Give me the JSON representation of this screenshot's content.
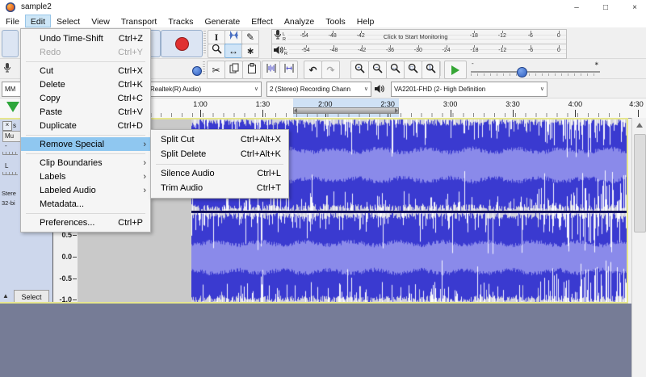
{
  "window": {
    "title": "sample2",
    "minimize": "–",
    "maximize": "□",
    "close": "×"
  },
  "menubar": {
    "items": [
      "File",
      "Edit",
      "Select",
      "View",
      "Transport",
      "Tracks",
      "Generate",
      "Effect",
      "Analyze",
      "Tools",
      "Help"
    ],
    "active": "Edit"
  },
  "edit_menu": {
    "items": [
      {
        "label": "Undo Time-Shift",
        "shortcut": "Ctrl+Z"
      },
      {
        "label": "Redo",
        "shortcut": "Ctrl+Y",
        "disabled": true,
        "separator_after": true
      },
      {
        "label": "Cut",
        "shortcut": "Ctrl+X"
      },
      {
        "label": "Delete",
        "shortcut": "Ctrl+K"
      },
      {
        "label": "Copy",
        "shortcut": "Ctrl+C"
      },
      {
        "label": "Paste",
        "shortcut": "Ctrl+V"
      },
      {
        "label": "Duplicate",
        "shortcut": "Ctrl+D",
        "separator_after": true
      },
      {
        "label": "Remove Special",
        "submenu": true,
        "highlighted": true,
        "separator_after": true
      },
      {
        "label": "Clip Boundaries",
        "submenu": true
      },
      {
        "label": "Labels",
        "submenu": true
      },
      {
        "label": "Labeled Audio",
        "submenu": true
      },
      {
        "label": "Metadata...",
        "separator_after": true
      },
      {
        "label": "Preferences...",
        "shortcut": "Ctrl+P"
      }
    ]
  },
  "remove_special_submenu": {
    "items": [
      {
        "label": "Split Cut",
        "shortcut": "Ctrl+Alt+X"
      },
      {
        "label": "Split Delete",
        "shortcut": "Ctrl+Alt+K",
        "separator_after": true
      },
      {
        "label": "Silence Audio",
        "shortcut": "Ctrl+L"
      },
      {
        "label": "Trim Audio",
        "shortcut": "Ctrl+T"
      }
    ]
  },
  "toolbars": {
    "tools": {
      "buttons": [
        "selection-tool",
        "envelope-tool",
        "draw-tool",
        "zoom-tool",
        "time-shift-tool",
        "multi-tool"
      ],
      "active": "time-shift-tool"
    },
    "edit": {
      "buttons": [
        "cut",
        "copy",
        "paste",
        "trim-audio",
        "silence-audio",
        "undo",
        "redo",
        "zoom-in",
        "zoom-out",
        "fit-selection",
        "fit-project",
        "zoom-toggle"
      ],
      "disabled": [
        "redo"
      ]
    },
    "meters": {
      "channel_labels": [
        "L",
        "R"
      ],
      "record_scale": [
        "-54",
        "-48",
        "-42",
        "-18",
        "-12",
        "-6",
        "0"
      ],
      "record_message": "Click to Start Monitoring",
      "playback_scale": [
        "-54",
        "-48",
        "-42",
        "-36",
        "-30",
        "-24",
        "-18",
        "-12",
        "-6",
        "0"
      ]
    },
    "play_at_speed": {
      "min_label": "-",
      "max_label": "∗"
    },
    "device": {
      "host": "MM",
      "recording_device": "Realtek(R) Audio)",
      "recording_channels": "2 (Stereo) Recording Chann",
      "playback_device": "VA2201-FHD (2- High Definition"
    }
  },
  "timeline": {
    "labels": [
      "1:00",
      "1:30",
      "2:00",
      "2:30",
      "3:00",
      "3:30",
      "4:00",
      "4:30"
    ]
  },
  "track": {
    "close": "×",
    "name": "s",
    "mute": "Mu",
    "gain": "-",
    "pan": "L",
    "info": [
      "Stere",
      "32-bi"
    ],
    "collapse": "▲",
    "select": "Select",
    "scale": [
      "0.5",
      "0.0",
      "-0.5",
      "-1.0"
    ]
  }
}
